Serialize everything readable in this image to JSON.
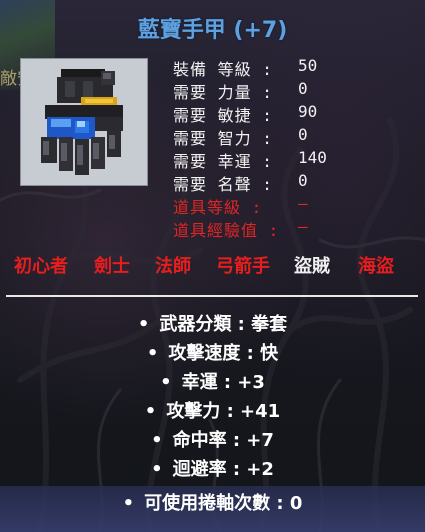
{
  "item": {
    "name": "藍寶手甲 (+7)",
    "icon": "blue-gem-gloves-icon"
  },
  "corner_label": "敵安",
  "requirements": [
    {
      "label": "裝備 等級 :",
      "value": "50",
      "status": "met"
    },
    {
      "label": "需要 力量 :",
      "value": "0",
      "status": "met"
    },
    {
      "label": "需要 敏捷 :",
      "value": "90",
      "status": "met"
    },
    {
      "label": "需要 智力 :",
      "value": "0",
      "status": "met"
    },
    {
      "label": "需要 幸運 :",
      "value": "140",
      "status": "met"
    },
    {
      "label": "需要 名聲 :",
      "value": "0",
      "status": "met"
    },
    {
      "label": "道具等級 :",
      "value": "–",
      "status": "unmet"
    },
    {
      "label": "道具經驗值 :",
      "value": "–",
      "status": "unmet"
    }
  ],
  "jobs": [
    {
      "name": "初心者",
      "usable": false
    },
    {
      "name": "劍士",
      "usable": false
    },
    {
      "name": "法師",
      "usable": false
    },
    {
      "name": "弓箭手",
      "usable": false
    },
    {
      "name": "盜賊",
      "usable": true
    },
    {
      "name": "海盜",
      "usable": false
    }
  ],
  "stats": [
    "武器分類 : 拳套",
    "攻擊速度 : 快",
    "幸運 : +3",
    "攻擊力 : +41",
    "命中率 : +7",
    "迴避率 : +2"
  ],
  "upgrade_slots": "可使用捲軸次數 : 0",
  "bullet": "•",
  "colors": {
    "title": "#5fa0e0",
    "unmet": "#e02525",
    "met": "#f2f2f2",
    "footer": "#373e6e"
  }
}
